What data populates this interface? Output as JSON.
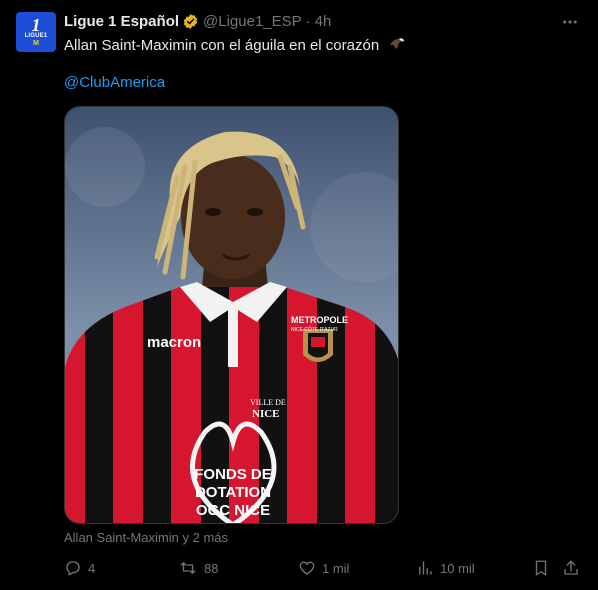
{
  "tweet": {
    "author_name": "Ligue 1 Español",
    "handle": "@Ligue1_ESP",
    "separator": "·",
    "time": "4h",
    "text": "Allan Saint-Maximin con el águila en el corazón",
    "mention": "@ClubAmerica",
    "avatar": {
      "line1": "1",
      "line2": "LIGUE1",
      "line3": "M"
    },
    "media": {
      "sponsor": "macron",
      "chest_sponsor": "METROPOLE",
      "chest_sponsor_sub": "NICE CÔTE D'AZUR",
      "sleeve_sponsor": "VILLE DE",
      "sleeve_sponsor_city": "NICE",
      "heart_text_1": "FONDS DE",
      "heart_text_2": "DOTATION",
      "heart_text_3": "OGC NICE"
    },
    "tagged": "Allan Saint-Maximin y 2 más",
    "actions": {
      "replies": "4",
      "reposts": "88",
      "likes": "1 mil",
      "views": "10 mil"
    }
  },
  "colors": {
    "background": "#000000",
    "text": "#e7e9ea",
    "muted": "#71767b",
    "link": "#1d9bf0",
    "verified": "#e2b719",
    "jersey_red": "#d6162e",
    "jersey_black": "#111111"
  }
}
